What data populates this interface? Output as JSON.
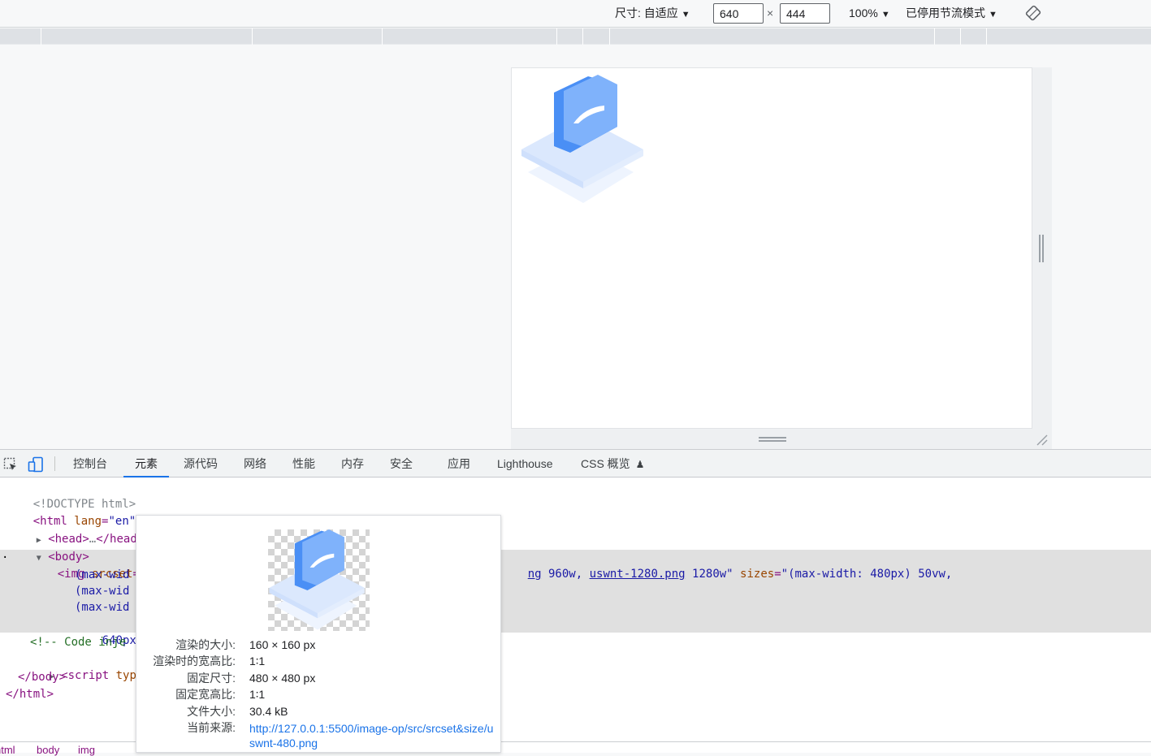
{
  "device_toolbar": {
    "size_label": "尺寸: 自适应",
    "width_value": "640",
    "times": "×",
    "height_value": "444",
    "zoom": "100%",
    "throttle": "已停用节流模式",
    "dropdown_arrow": "▼"
  },
  "devtools": {
    "tabs": [
      {
        "label": "控制台"
      },
      {
        "label": "元素"
      },
      {
        "label": "源代码"
      },
      {
        "label": "网络"
      },
      {
        "label": "性能"
      },
      {
        "label": "内存"
      },
      {
        "label": "安全"
      },
      {
        "label": "应用"
      },
      {
        "label": "Lighthouse"
      },
      {
        "label": "CSS 概览"
      }
    ],
    "active_tab": "元素",
    "flask_glyph": "♟"
  },
  "dom": {
    "doctype": "<!DOCTYPE html>",
    "html_open_tag": "<html",
    "lang_attr": " lang",
    "lang_eq": "=",
    "lang_val": "\"en\"",
    "html_open_end": ">",
    "head_open": "<head>",
    "ellipsis": "…",
    "head_close": "</head>",
    "body_open": "<body>",
    "img_open": "<img",
    "srcset_attr": " srcset",
    "srcset_eq": "=",
    "srcset_start": "\"",
    "srcset_first_link": "us",
    "srcset_tail_link1": "ng",
    "srcset_tail_mid": " 960w, ",
    "srcset_tail_link2": "uswnt-1280.png",
    "srcset_tail_end": " 1280w\"",
    "sizes_attr": " sizes",
    "sizes_eq": "=",
    "sizes_val": "\"(max-width: 480px) 50vw,",
    "cont1": "(max-wid",
    "cont2": "(max-wid",
    "cont3": "(max-wid",
    "cont4_val": "640px\"",
    "cont4_attr": " s",
    "comment": "<!-- Code inje",
    "script_open": "<script",
    "script_type_attr": " type",
    "script_eq": "=",
    "script_val": "\"",
    "body_close": "</body>",
    "html_close": "</html>",
    "selected_marker": "·"
  },
  "breadcrumb": [
    "html",
    "body",
    "img"
  ],
  "tooltip": {
    "rows": [
      {
        "key": "渲染的大小:",
        "value": "160 × 160 px"
      },
      {
        "key": "渲染时的宽高比:",
        "value": "1∶1"
      },
      {
        "key": "固定尺寸:",
        "value": "480 × 480 px"
      },
      {
        "key": "固定宽高比:",
        "value": "1∶1"
      },
      {
        "key": "文件大小:",
        "value": "30.4 kB"
      }
    ],
    "source_key": "当前来源:",
    "source_url": "http://127.0.0.1:5500/image-op/src/srcset&size/uswnt-480.png"
  },
  "colors": {
    "accent": "#1a73e8",
    "folder_blue": "#4a8ff5",
    "folder_light": "#7fb2fb",
    "platform": "#dbeafe"
  }
}
